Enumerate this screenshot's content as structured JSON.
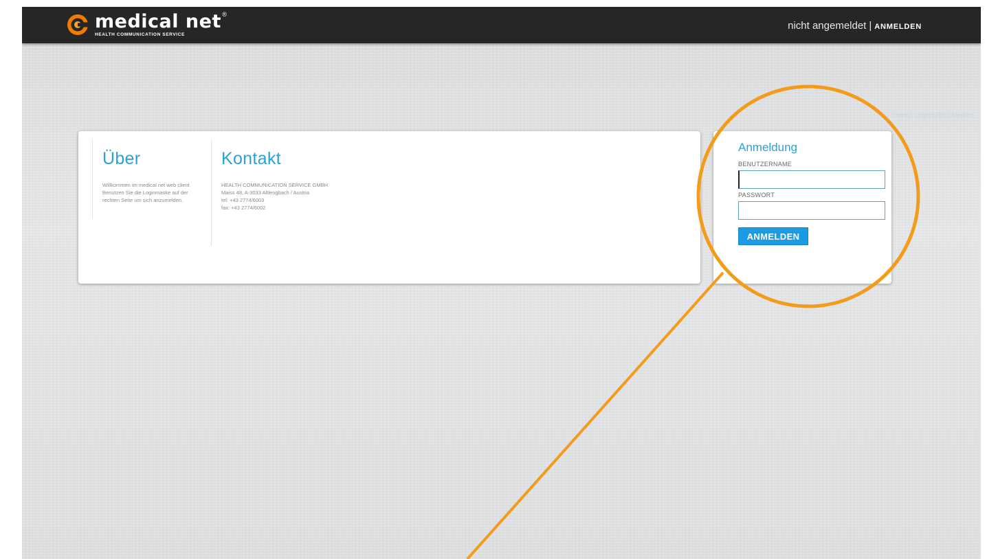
{
  "header": {
    "logo_name": "medical net",
    "logo_reg": "®",
    "logo_tagline": "HEALTH COMMUNICATION SERVICE",
    "status_text": "nicht angemeldet",
    "separator": "|",
    "login_link": "ANMELDEN"
  },
  "ghost_link": "Immer angemeldet bleiben",
  "about": {
    "title": "Über",
    "lines": [
      "Willkommen im medical net web client",
      "Benutzen Sie die Loginmaske auf der",
      "rechten Seite um sich anzumelden."
    ]
  },
  "contact": {
    "title": "Kontakt",
    "company": "HEALTH COMMUNICATION SERVICE GMBH",
    "address": "Maiss 48, A-3033 Altlengbach / Austria",
    "tel": "tel: +43 2774/6003",
    "fax": "fax: +43 2774/6002"
  },
  "login": {
    "title": "Anmeldung",
    "username_label": "BENUTZERNAME",
    "username_value": "",
    "password_label": "PASSWORT",
    "password_value": "",
    "submit_label": "ANMELDEN"
  },
  "colors": {
    "accent_blue": "#2aa2d6",
    "button_blue": "#1a9be3",
    "topbar": "#262626",
    "annotation_orange": "#f39c1c",
    "logo_orange": "#f07c00"
  },
  "icons": {
    "logo": "medical-net-logo-icon"
  }
}
